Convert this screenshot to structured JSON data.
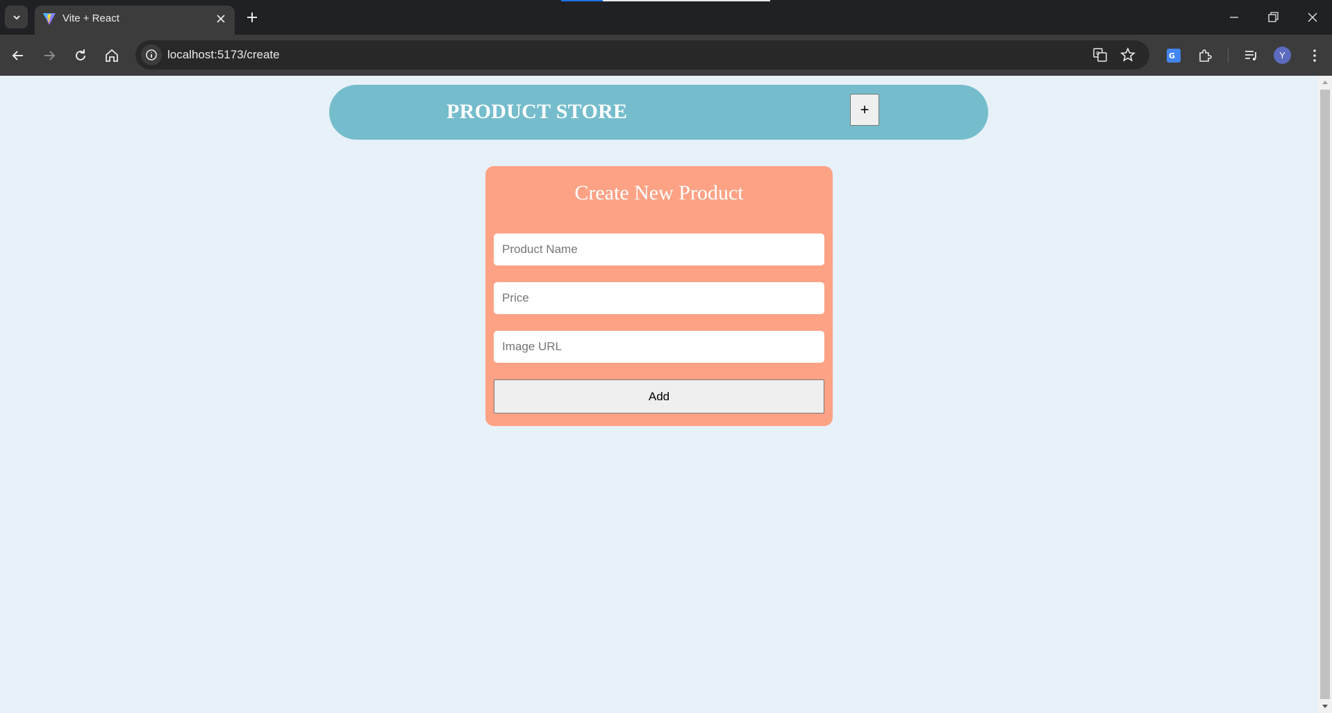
{
  "browser": {
    "tab_title": "Vite + React",
    "url": "localhost:5173/create",
    "profile_initial": "Y"
  },
  "app": {
    "brand": "PRODUCT STORE",
    "create_button_label": "+",
    "form": {
      "title": "Create New Product",
      "name_placeholder": "Product Name",
      "price_placeholder": "Price",
      "image_placeholder": "Image URL",
      "submit_label": "Add"
    }
  },
  "colors": {
    "page_bg": "#e7f1f8",
    "navbar_bg": "#75bdcc",
    "card_bg": "#fea285"
  }
}
